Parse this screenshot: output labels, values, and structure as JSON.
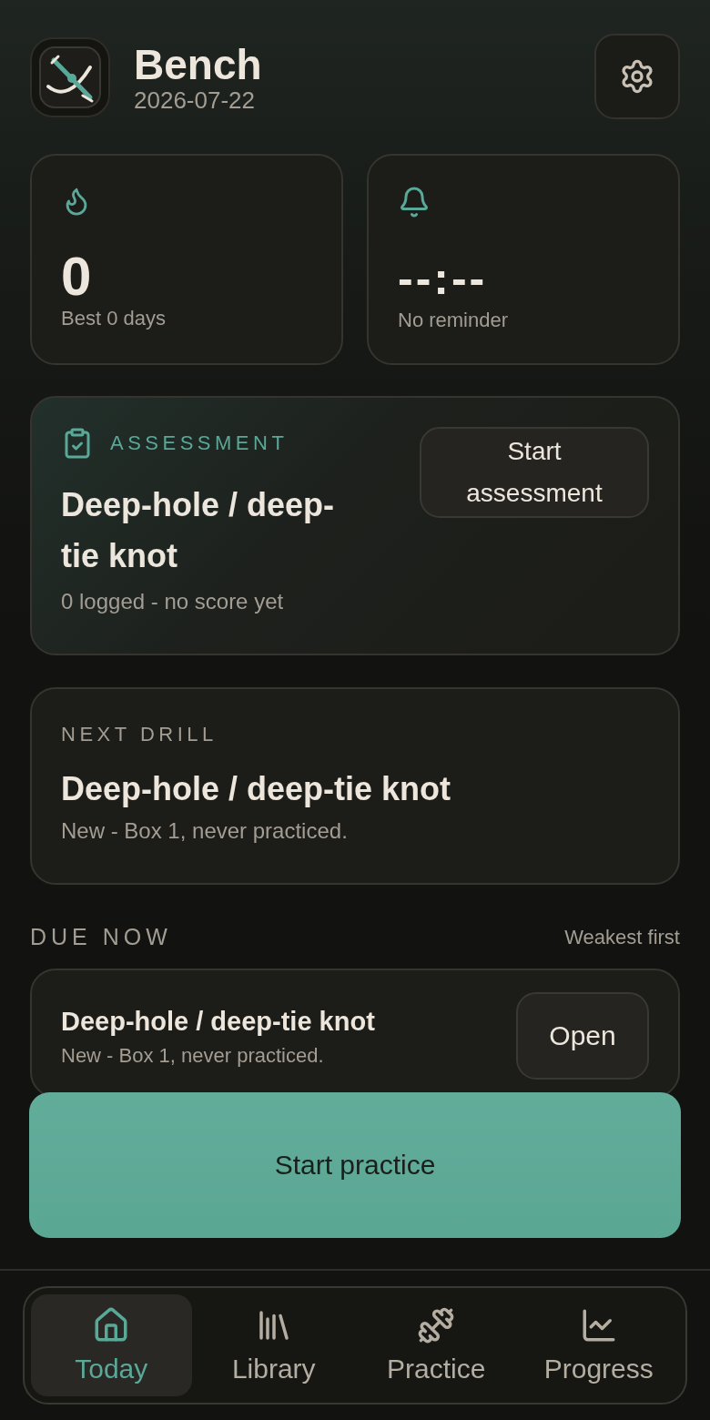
{
  "header": {
    "title": "Bench",
    "date": "2026-07-22"
  },
  "stats": [
    {
      "kind": "streak",
      "value": "0",
      "label": "Best 0 days"
    },
    {
      "kind": "reminder",
      "value": "--:--",
      "label": "No reminder"
    }
  ],
  "assessment": {
    "eyebrow": "ASSESSMENT",
    "title": "Deep-hole / deep-tie knot",
    "subtitle": "0 logged - no score yet",
    "button": "Start assessment"
  },
  "next_drill": {
    "eyebrow": "NEXT DRILL",
    "title": "Deep-hole / deep-tie knot",
    "subtitle": "New - Box 1, never practiced."
  },
  "due_now": {
    "heading": "DUE NOW",
    "sort": "Weakest first",
    "items": [
      {
        "title": "Deep-hole / deep-tie knot",
        "subtitle": "New - Box 1, never practiced.",
        "button": "Open"
      }
    ]
  },
  "primary_button": "Start practice",
  "nav": [
    {
      "kind": "home",
      "label": "Today",
      "selected": true
    },
    {
      "kind": "library",
      "label": "Library",
      "selected": false
    },
    {
      "kind": "practice",
      "label": "Practice",
      "selected": false
    },
    {
      "kind": "progress",
      "label": "Progress",
      "selected": false
    }
  ]
}
